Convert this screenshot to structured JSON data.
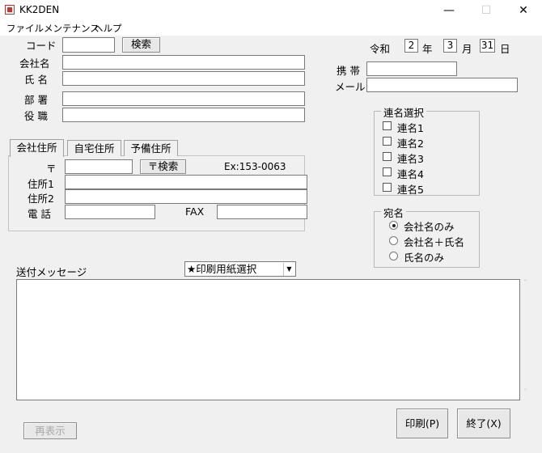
{
  "window": {
    "title": "KK2DEN",
    "minimize": "—",
    "maximize": "☐",
    "close": "✕"
  },
  "menu": {
    "file": "ファイル",
    "maintenance": "メンテナンス",
    "help": "ヘルプ"
  },
  "form": {
    "code_label": "コード",
    "code_value": "",
    "search_button": "検索",
    "company_label": "会社名",
    "name_label": "氏 名",
    "dept_label": "部 署",
    "title_label": "役 職"
  },
  "date": {
    "era": "令和",
    "year": "2",
    "year_label": "年",
    "month": "3",
    "month_label": "月",
    "day": "31",
    "day_label": "日"
  },
  "contact": {
    "mobile_label": "携 帯",
    "mail_label": "メール"
  },
  "address_tabs": {
    "tabs": [
      "会社住所",
      "自宅住所",
      "予備住所"
    ],
    "postal_label": "〒",
    "postal_search_button": "〒検索",
    "postal_example": "Ex:153-0063",
    "addr1_label": "住所1",
    "addr2_label": "住所2",
    "tel_label": "電 話",
    "fax_label": "FAX"
  },
  "joint_names": {
    "title": "連名選択",
    "items": [
      "連名1",
      "連名2",
      "連名3",
      "連名4",
      "連名5"
    ]
  },
  "addressee": {
    "title": "宛名",
    "options": [
      "会社名のみ",
      "会社名＋氏名",
      "氏名のみ"
    ],
    "selected": "会社名のみ"
  },
  "message": {
    "label": "送付メッセージ",
    "paper_select": "★印刷用紙選択",
    "scroll_up": "˄",
    "scroll_down": "˅"
  },
  "footer": {
    "redisplay_button": "再表示",
    "print_button": "印刷(P)",
    "exit_button": "終了(X)"
  }
}
